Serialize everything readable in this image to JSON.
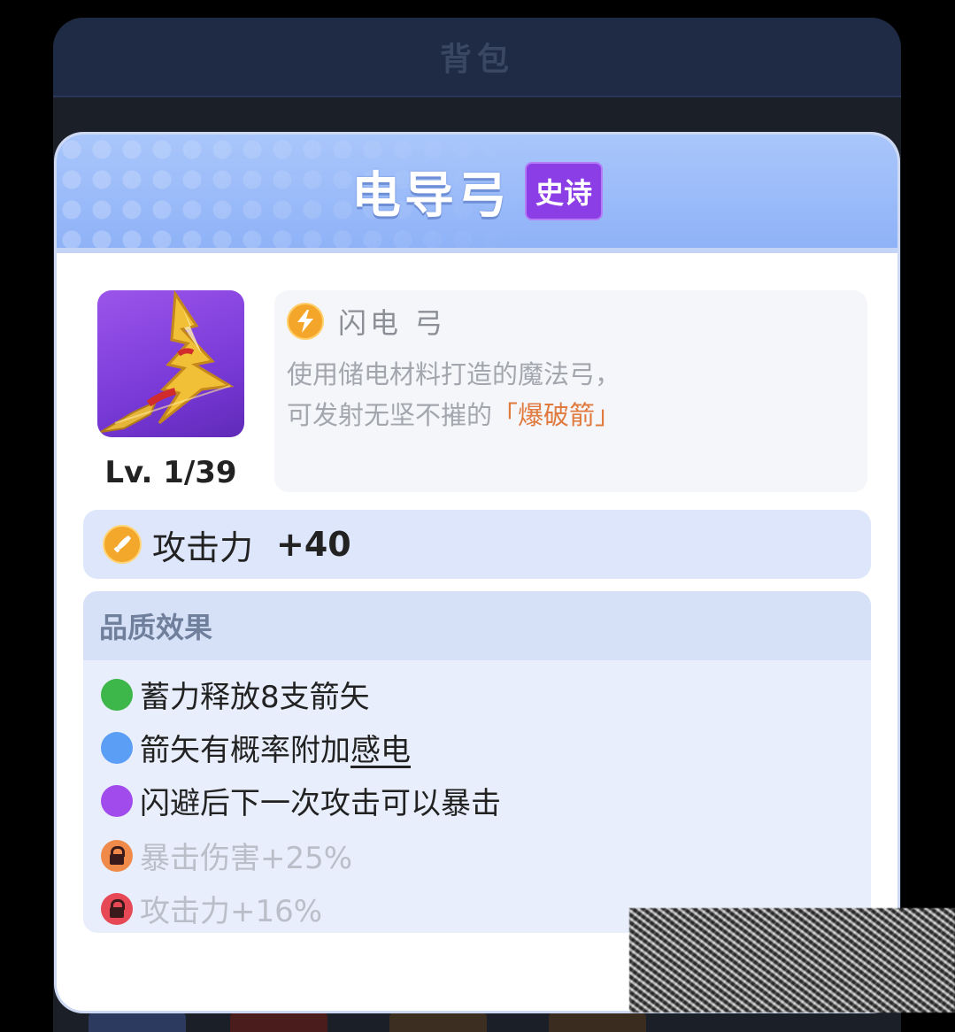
{
  "background": {
    "title": "背包"
  },
  "card": {
    "title": "电导弓",
    "rarity": "史诗"
  },
  "item": {
    "level": "Lv. 1/39",
    "name": "闪电 弓",
    "desc_line1": "使用储电材料打造的魔法弓，",
    "desc_line2_prefix": "可发射无坚不摧的",
    "desc_line2_highlight": "「爆破箭」"
  },
  "attack": {
    "label": "攻击力",
    "value": "+40"
  },
  "quality": {
    "title": "品质效果",
    "effects": [
      {
        "text_before": "蓄力释放8支箭矢",
        "text_underline": "",
        "color": "#3db64a",
        "locked": false
      },
      {
        "text_before": "箭矢有概率附加",
        "text_underline": "感电",
        "color": "#5a9ef5",
        "locked": false
      },
      {
        "text_before": "闪避后下一次攻击可以暴击",
        "text_underline": "",
        "color": "#a24bec",
        "locked": false
      },
      {
        "text_before": "暴击伤害+25%",
        "text_underline": "",
        "color": "#f08a4b",
        "locked": true
      },
      {
        "text_before": "攻击力+16%",
        "text_underline": "",
        "color": "#e64856",
        "locked": true
      }
    ]
  },
  "colors": {
    "rarity_purple": "#8c3ee6",
    "header_blue": "#8fb2f7",
    "highlight_orange": "#e07a3e"
  },
  "icons": {
    "item": "lightning-bow-icon",
    "bolt": "lightning-bolt-icon",
    "attack": "sword-icon",
    "lock": "lock-icon"
  }
}
